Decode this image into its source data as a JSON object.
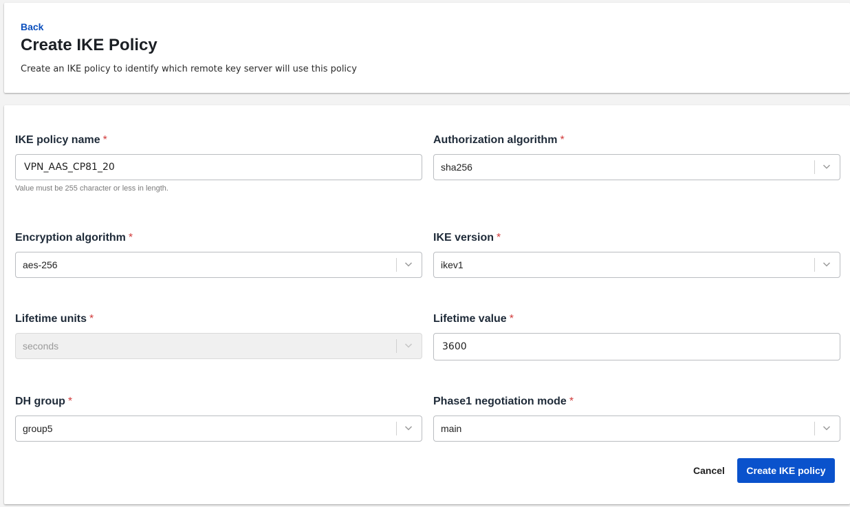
{
  "header": {
    "back_label": "Back",
    "title": "Create IKE Policy",
    "description": "Create an IKE policy to identify which remote key server will use this policy"
  },
  "form": {
    "required_marker": "*",
    "ike_policy_name": {
      "label": "IKE policy name",
      "value": "VPN_AAS_CP81_20",
      "hint": "Value must be 255 character or less in length."
    },
    "authorization_algorithm": {
      "label": "Authorization algorithm",
      "value": "sha256"
    },
    "encryption_algorithm": {
      "label": "Encryption algorithm",
      "value": "aes-256"
    },
    "ike_version": {
      "label": "IKE version",
      "value": "ikev1"
    },
    "lifetime_units": {
      "label": "Lifetime units",
      "value": "seconds",
      "disabled": true
    },
    "lifetime_value": {
      "label": "Lifetime value",
      "value": "3600"
    },
    "dh_group": {
      "label": "DH group",
      "value": "group5"
    },
    "phase1_negotiation_mode": {
      "label": "Phase1 negotiation mode",
      "value": "main"
    }
  },
  "actions": {
    "cancel_label": "Cancel",
    "submit_label": "Create IKE policy"
  },
  "icons": {
    "select_indicator": "chevron-down-icon"
  },
  "colors": {
    "primary": "#0a52cc",
    "link": "#0b4fbd",
    "required": "#d13b3b"
  }
}
